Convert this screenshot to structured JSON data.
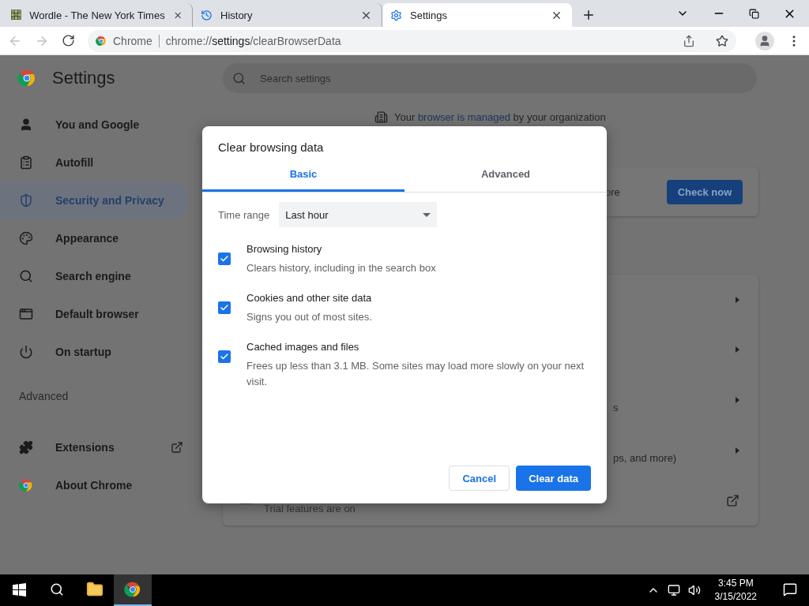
{
  "browser_tabs": [
    {
      "title": "Wordle - The New York Times",
      "kind": "grid",
      "selected": false
    },
    {
      "title": "History",
      "kind": "history",
      "selected": false
    },
    {
      "title": "Settings",
      "kind": "gear",
      "selected": true
    }
  ],
  "toolbar": {
    "back": {
      "disabled": true
    },
    "forward": {
      "disabled": true
    },
    "chip": "Chrome",
    "url": {
      "scheme": "chrome://",
      "host": "settings",
      "path": "/clearBrowserData"
    }
  },
  "settings": {
    "title": "Settings",
    "search": {
      "placeholder": "Search settings"
    },
    "sidebar": {
      "items": [
        {
          "label": "You and Google",
          "kind": "person",
          "selected": false
        },
        {
          "label": "Autofill",
          "kind": "clipboard",
          "selected": false
        },
        {
          "label": "Security and Privacy",
          "kind": "shield",
          "selected": true
        },
        {
          "label": "Appearance",
          "kind": "palette",
          "selected": false
        },
        {
          "label": "Search engine",
          "kind": "search",
          "selected": false
        },
        {
          "label": "Default browser",
          "kind": "browser",
          "selected": false
        },
        {
          "label": "On startup",
          "kind": "power",
          "selected": false
        }
      ],
      "advanced": "Advanced",
      "bottom_items": [
        {
          "label": "Extensions",
          "kind": "puzzle"
        },
        {
          "label": "About Chrome",
          "kind": "chrome"
        }
      ]
    },
    "managed_banner": {
      "prefix": "Your ",
      "link": "browser is managed",
      "suffix": " by your organization"
    },
    "safety_card": {
      "text": "ore",
      "button": "Check now"
    },
    "privacy_rows": [
      {
        "kind": "arrow"
      },
      {
        "kind": "arrow"
      },
      {
        "kind": "arrow",
        "text": "s"
      },
      {
        "kind": "arrow",
        "text": "ps, and more)"
      },
      {
        "kind": "external",
        "text": "Trial features are on"
      }
    ]
  },
  "dialog": {
    "title": "Clear browsing data",
    "tabs": [
      {
        "label": "Basic",
        "selected": true
      },
      {
        "label": "Advanced",
        "selected": false
      }
    ],
    "time_range": {
      "label": "Time range",
      "value": "Last hour"
    },
    "options": [
      {
        "title": "Browsing history",
        "description": "Clears history, including in the search box",
        "checked": true
      },
      {
        "title": "Cookies and other site data",
        "description": "Signs you out of most sites.",
        "checked": true
      },
      {
        "title": "Cached images and files",
        "description": "Frees up less than 3.1 MB. Some sites may load more slowly on your next visit.",
        "checked": true
      }
    ],
    "cancel": "Cancel",
    "confirm": "Clear data"
  },
  "taskbar": {
    "apps": [
      {
        "kind": "folder",
        "active": false
      },
      {
        "kind": "chrome",
        "active": true
      }
    ],
    "time": "3:45 PM",
    "date": "3/15/2022"
  }
}
